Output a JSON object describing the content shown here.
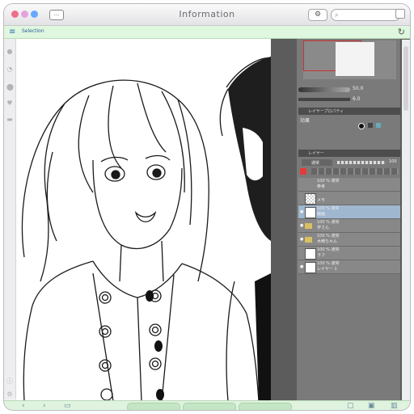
{
  "window": {
    "title": "Information",
    "search_icon": "⌕",
    "gear_icon": "⚙",
    "chat_icon": "…"
  },
  "toolbar": {
    "menu_icon": "≡",
    "selection_label": "Selection",
    "refresh_icon": "↻"
  },
  "sidebar": {
    "icons": [
      "person-icon",
      "clock-icon",
      "location-icon",
      "heart-icon",
      "list-icon"
    ]
  },
  "panel": {
    "brush_size": "50.0",
    "brush_opacity": "6.0",
    "layer_property_tab": "レイヤープロパティ",
    "effect_label": "効果",
    "layer_tab": "レイヤー",
    "blend_mode": "通常",
    "opacity_value": "100",
    "layers": [
      {
        "meta": "100 % 通常",
        "name": "参考",
        "folder": true
      },
      {
        "meta": "",
        "name": "メモ",
        "folder": false
      },
      {
        "meta": "100 % 通常",
        "name": "線画",
        "folder": false,
        "selected": true
      },
      {
        "meta": "100 % 通常",
        "name": "学さん",
        "folder": true
      },
      {
        "meta": "100 % 通常",
        "name": "木崎ちゃん",
        "folder": true
      },
      {
        "meta": "100 % 通常",
        "name": "ラフ",
        "folder": false
      },
      {
        "meta": "100 % 通常",
        "name": "レイヤー 1",
        "folder": false
      }
    ]
  },
  "colors": {
    "accent_green": "#dff6df",
    "selected_layer": "#9fb7cf",
    "red_swatch": "#e53a3a"
  }
}
